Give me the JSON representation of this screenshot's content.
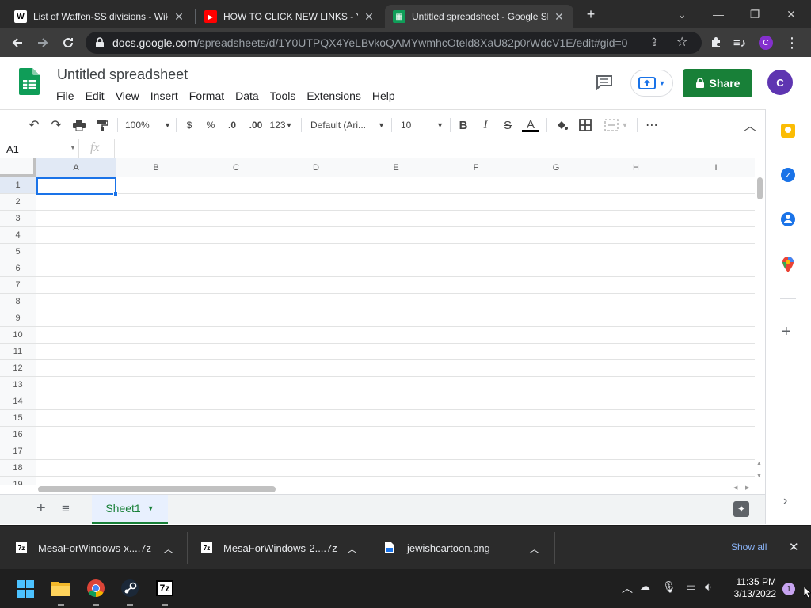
{
  "browser": {
    "tabs": [
      {
        "title": "List of Waffen-SS divisions - Wiki",
        "favicon": "W",
        "favicon_color": "#ffffff",
        "favicon_text_color": "#000000"
      },
      {
        "title": "HOW TO CLICK NEW LINKS - You",
        "favicon": "▶",
        "favicon_color": "#ff0000",
        "favicon_text_color": "#ffffff"
      },
      {
        "title": "Untitled spreadsheet - Google Sh",
        "favicon": "▦",
        "favicon_color": "#0f9d58",
        "favicon_text_color": "#ffffff"
      }
    ],
    "new_tab": "+",
    "url_host": "docs.google.com",
    "url_path": "/spreadsheets/d/1Y0UTPQX4YeLBvkoQAMYwmhcOteld8XaU82p0rWdcV1E/edit#gid=0",
    "profile_initial": "C"
  },
  "sheets": {
    "title": "Untitled spreadsheet",
    "menu": [
      "File",
      "Edit",
      "View",
      "Insert",
      "Format",
      "Data",
      "Tools",
      "Extensions",
      "Help"
    ],
    "share_label": "Share",
    "avatar": "C",
    "toolbar": {
      "zoom": "100%",
      "currency": "$",
      "percent": "%",
      "dec_decrease": ".0",
      "dec_increase": ".00",
      "more_formats": "123",
      "font": "Default (Ari...",
      "font_size": "10",
      "bold": "B",
      "italic": "I",
      "strike": "S",
      "text_color": "A",
      "more": "⋯"
    },
    "name_box": "A1",
    "fx": "fx",
    "columns": [
      "A",
      "B",
      "C",
      "D",
      "E",
      "F",
      "G",
      "H",
      "I"
    ],
    "rows": [
      "1",
      "2",
      "3",
      "4",
      "5",
      "6",
      "7",
      "8",
      "9",
      "10",
      "11",
      "12",
      "13",
      "14",
      "15",
      "16",
      "17",
      "18",
      "19"
    ],
    "sheet_tab": "Sheet1"
  },
  "downloads": {
    "items": [
      {
        "name": "MesaForWindows-x....7z"
      },
      {
        "name": "MesaForWindows-2....7z"
      },
      {
        "name": "jewishcartoon.png"
      }
    ],
    "show_all": "Show all"
  },
  "taskbar": {
    "time": "11:35 PM",
    "date": "3/13/2022",
    "notification_count": "1"
  },
  "colors": {
    "tab_strip": "#2b2b2b",
    "toolbar": "#3c3c3c",
    "share_green": "#188038",
    "selection_blue": "#1a73e8",
    "avatar_purple": "#5e35b1"
  }
}
